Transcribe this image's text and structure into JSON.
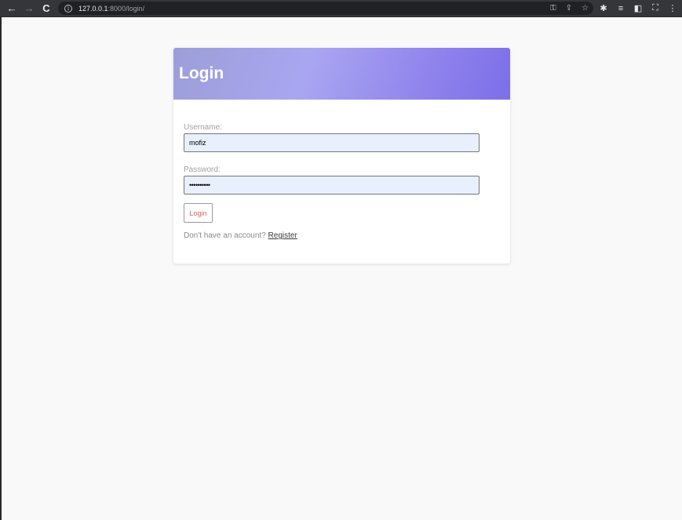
{
  "browser": {
    "url_host": "127.0.0.1",
    "url_rest": ":8000/login/",
    "back_icon": "arrow-left-icon",
    "forward_icon": "arrow-right-icon",
    "reload_icon": "reload-icon"
  },
  "login": {
    "title": "Login",
    "username_label": "Username:",
    "username_value": "mofiz",
    "password_label": "Password:",
    "password_masked": "••••••••••",
    "submit_label": "Login",
    "register_prompt": "Don't have an account?",
    "register_link": "Register"
  },
  "colors": {
    "header_gradient_start": "#9c9ed8",
    "header_gradient_end": "#7c6ee9",
    "input_autofill_bg": "#e8f0fe",
    "submit_text": "#e0605c"
  }
}
